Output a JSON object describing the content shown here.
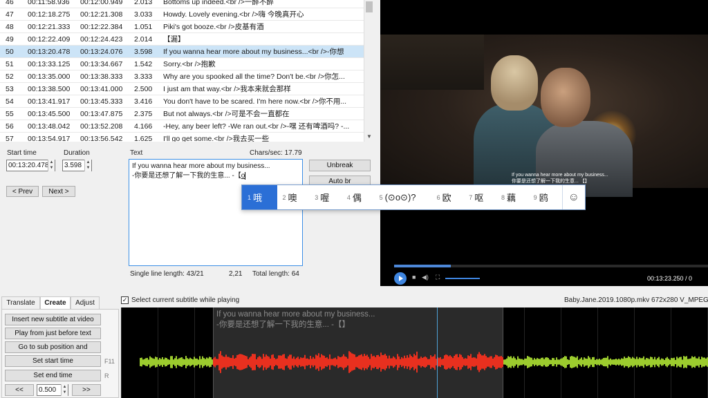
{
  "grid": {
    "rows": [
      {
        "num": "46",
        "start": "00:11:58.936",
        "end": "00:12:00.949",
        "dur": "2.013",
        "text": "Bottoms up indeed.<br />一醉不醉",
        "selected": false
      },
      {
        "num": "47",
        "start": "00:12:18.275",
        "end": "00:12:21.308",
        "dur": "3.033",
        "text": "Howdy. Lovely evening.<br />嗨 今晚真开心",
        "selected": false
      },
      {
        "num": "48",
        "start": "00:12:21.333",
        "end": "00:12:22.384",
        "dur": "1.051",
        "text": "Piki's got booze.<br />皮基有酒",
        "selected": false
      },
      {
        "num": "49",
        "start": "00:12:22.409",
        "end": "00:12:24.423",
        "dur": "2.014",
        "text": "【漏】",
        "selected": false
      },
      {
        "num": "50",
        "start": "00:13:20.478",
        "end": "00:13:24.076",
        "dur": "3.598",
        "text": "If you wanna hear more about my business...<br />-你想",
        "selected": true
      },
      {
        "num": "51",
        "start": "00:13:33.125",
        "end": "00:13:34.667",
        "dur": "1.542",
        "text": "Sorry.<br />抱歉",
        "selected": false
      },
      {
        "num": "52",
        "start": "00:13:35.000",
        "end": "00:13:38.333",
        "dur": "3.333",
        "text": "Why are you spooked all the time? Don't be.<br />你怎...",
        "selected": false
      },
      {
        "num": "53",
        "start": "00:13:38.500",
        "end": "00:13:41.000",
        "dur": "2.500",
        "text": "I just am that way.<br />我本来就会那样",
        "selected": false
      },
      {
        "num": "54",
        "start": "00:13:41.917",
        "end": "00:13:45.333",
        "dur": "3.416",
        "text": "You don't have to be scared. I'm here now.<br />你不用...",
        "selected": false
      },
      {
        "num": "55",
        "start": "00:13:45.500",
        "end": "00:13:47.875",
        "dur": "2.375",
        "text": "But not always.<br />可是不会一直都在",
        "selected": false
      },
      {
        "num": "56",
        "start": "00:13:48.042",
        "end": "00:13:52.208",
        "dur": "4.166",
        "text": "-Hey, any beer left? -We ran out.<br />-嘿 还有啤酒吗? -...",
        "selected": false
      },
      {
        "num": "57",
        "start": "00:13:54.917",
        "end": "00:13:56.542",
        "dur": "1.625",
        "text": "I'll go get some.<br />我去买一些",
        "selected": false
      }
    ]
  },
  "edit": {
    "start_label": "Start time",
    "duration_label": "Duration",
    "text_label": "Text",
    "chars_sec": "Chars/sec: 17.79",
    "start_value": "00:13:20.478",
    "duration_value": "3.598",
    "prev_label": "< Prev",
    "next_label": "Next >",
    "text_line1": "If you wanna hear more about my business...",
    "text_line2_prefix": "-你要是还想了解一下我的生意... -【",
    "text_line2_composing": "o",
    "unbreak_label": "Unbreak",
    "autobr_label": "Auto br",
    "single_line_length": "Single line length: 43/21",
    "cursor_pos": "2,21",
    "total_length": "Total length: 64"
  },
  "ime": {
    "candidates": [
      {
        "n": "1",
        "ch": "哦"
      },
      {
        "n": "2",
        "ch": "噢"
      },
      {
        "n": "3",
        "ch": "喔"
      },
      {
        "n": "4",
        "ch": "偶"
      },
      {
        "n": "5",
        "ch": "(⊙o⊙)?"
      },
      {
        "n": "6",
        "ch": "欧"
      },
      {
        "n": "7",
        "ch": "呕"
      },
      {
        "n": "8",
        "ch": "藕"
      },
      {
        "n": "9",
        "ch": "鸥"
      }
    ],
    "smiley": "☺"
  },
  "video": {
    "sub_line1": "If you wanna hear more about my business...",
    "sub_line2": "你要是还想了解一下我的生意... 【】",
    "time": "00:13:23.250 / 0",
    "progress": 0.18
  },
  "tabs": {
    "translate": "Translate",
    "create": "Create",
    "adjust": "Adjust"
  },
  "create": {
    "insert": "Insert new subtitle at video",
    "play_before": "Play from just before text",
    "goto_sub": "Go to sub position and",
    "set_start": "Set start time",
    "set_end": "Set end time",
    "f11": "F11",
    "r": "R",
    "back": "<<",
    "step": "0.500",
    "fwd": ">>"
  },
  "waveform": {
    "select_current": "Select current subtitle while playing",
    "file_info": "Baby.Jane.2019.1080p.mkv 672x280 V_MPEG4",
    "sub_line1": "If you wanna hear more about my business...",
    "sub_line2": "-你要是还想了解一下我的生意... -【】",
    "colors": {
      "normal": "#9ccc2e",
      "selected": "#e8301f",
      "cursor": "#4fa3d8"
    }
  }
}
